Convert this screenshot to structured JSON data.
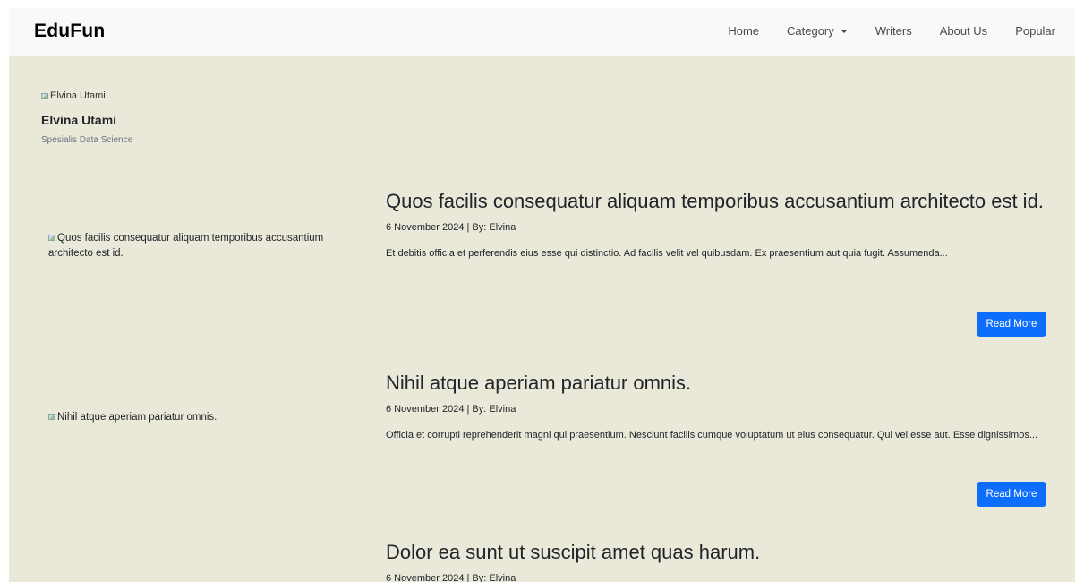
{
  "navbar": {
    "brand": "EduFun",
    "items": [
      {
        "label": "Home"
      },
      {
        "label": "Category",
        "dropdown": true
      },
      {
        "label": "Writers"
      },
      {
        "label": "About Us"
      },
      {
        "label": "Popular"
      }
    ]
  },
  "writer": {
    "image_alt": "Elvina Utami",
    "name": "Elvina Utami",
    "role": "Spesialis Data Science"
  },
  "posts": [
    {
      "image_alt": "Quos facilis consequatur aliquam temporibus accusantium architecto est id.",
      "title": "Quos facilis consequatur aliquam temporibus accusantium architecto est id.",
      "meta": "6 November 2024 | By: Elvina",
      "excerpt": "Et debitis officia et perferendis eius esse qui distinctio. Ad facilis velit vel quibusdam. Ex praesentium aut quia fugit. Assumenda...",
      "button": "Read More"
    },
    {
      "image_alt": "Nihil atque aperiam pariatur omnis.",
      "title": "Nihil atque aperiam pariatur omnis.",
      "meta": "6 November 2024 | By: Elvina",
      "excerpt": "Officia et corrupti reprehenderit magni qui praesentium. Nesciunt facilis cumque voluptatum ut eius consequatur. Qui vel esse aut. Esse dignissimos...",
      "button": "Read More"
    },
    {
      "image_alt": "",
      "title": "Dolor ea sunt ut suscipit amet quas harum.",
      "meta": "6 November 2024 | By: Elvina"
    }
  ],
  "colors": {
    "page_background": "#eae9d9",
    "navbar_background": "#f8f9fa",
    "button_primary": "#0d6efd"
  }
}
